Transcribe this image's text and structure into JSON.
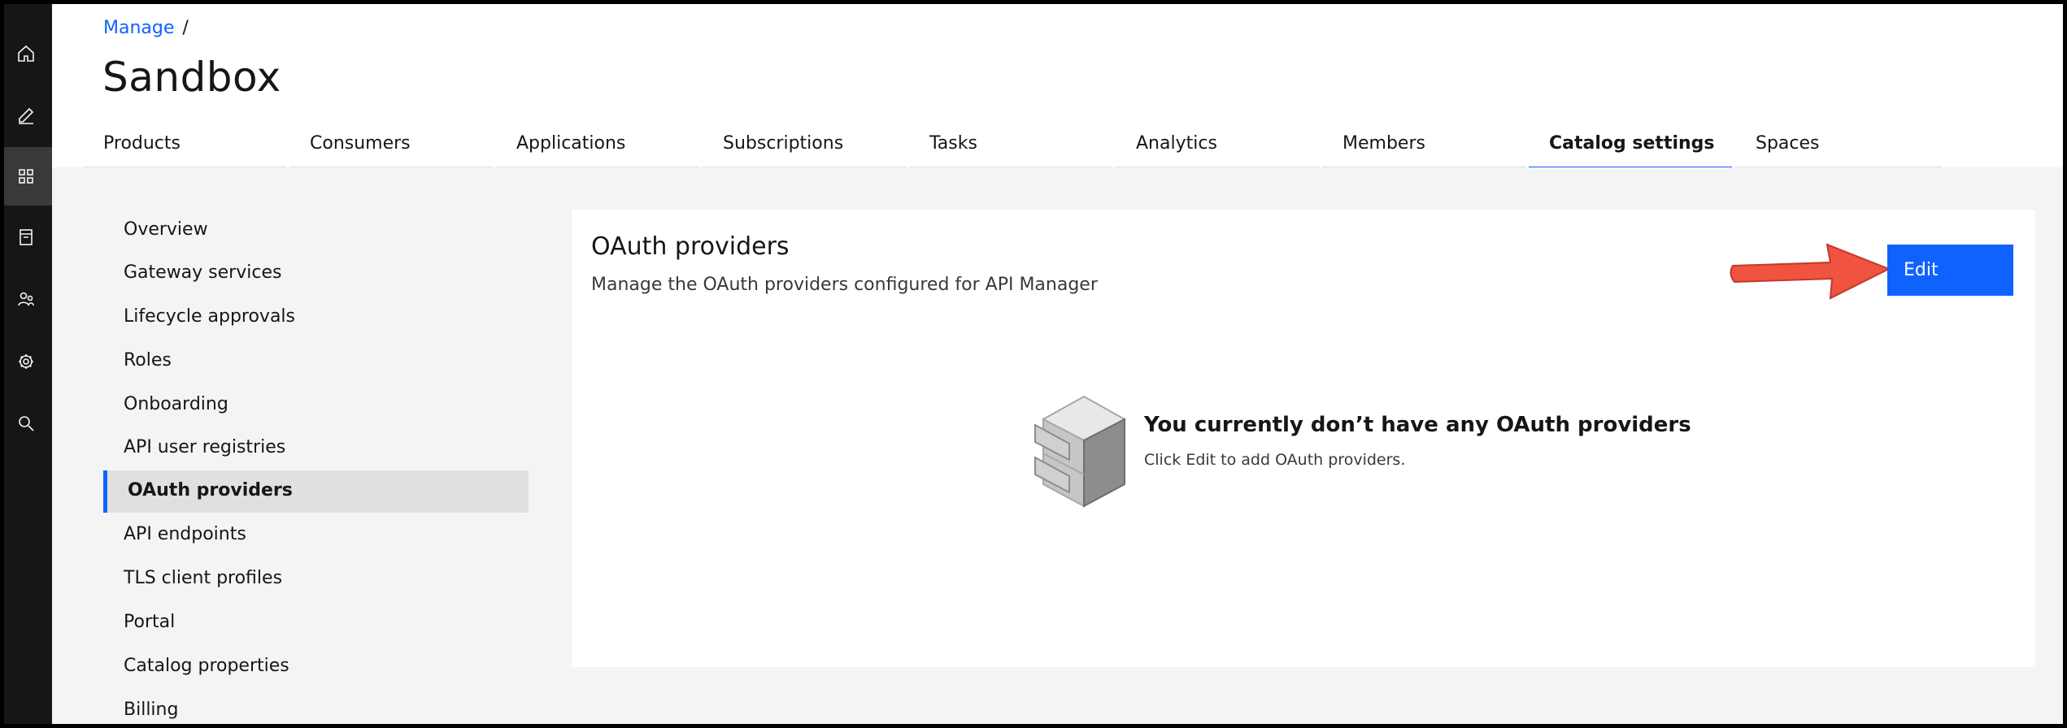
{
  "breadcrumb": {
    "items": [
      {
        "label": "Manage"
      }
    ],
    "separator": "/"
  },
  "page_title": "Sandbox",
  "tabs": [
    {
      "label": "Products"
    },
    {
      "label": "Consumers"
    },
    {
      "label": "Applications"
    },
    {
      "label": "Subscriptions"
    },
    {
      "label": "Tasks"
    },
    {
      "label": "Analytics"
    },
    {
      "label": "Members"
    },
    {
      "label": "Catalog settings",
      "active": true
    },
    {
      "label": "Spaces"
    }
  ],
  "rail": {
    "icons": [
      "home-icon",
      "edit-icon",
      "manage-grid-icon",
      "catalog-icon",
      "members-icon",
      "settings-icon",
      "search-icon"
    ]
  },
  "sidenav": {
    "items": [
      {
        "label": "Overview"
      },
      {
        "label": "Gateway services"
      },
      {
        "label": "Lifecycle approvals"
      },
      {
        "label": "Roles"
      },
      {
        "label": "Onboarding"
      },
      {
        "label": "API user registries"
      },
      {
        "label": "OAuth providers",
        "active": true
      },
      {
        "label": "API endpoints"
      },
      {
        "label": "TLS client profiles"
      },
      {
        "label": "Portal"
      },
      {
        "label": "Catalog properties"
      },
      {
        "label": "Billing"
      }
    ]
  },
  "panel": {
    "title": "OAuth providers",
    "description": "Manage the OAuth providers configured for API Manager",
    "edit_label": "Edit",
    "empty_title": "You currently don’t have any OAuth providers",
    "empty_subtitle": "Click Edit to add OAuth providers."
  },
  "colors": {
    "accent": "#0f62fe",
    "rail": "#161616",
    "annotation_arrow": "#f0533f"
  }
}
